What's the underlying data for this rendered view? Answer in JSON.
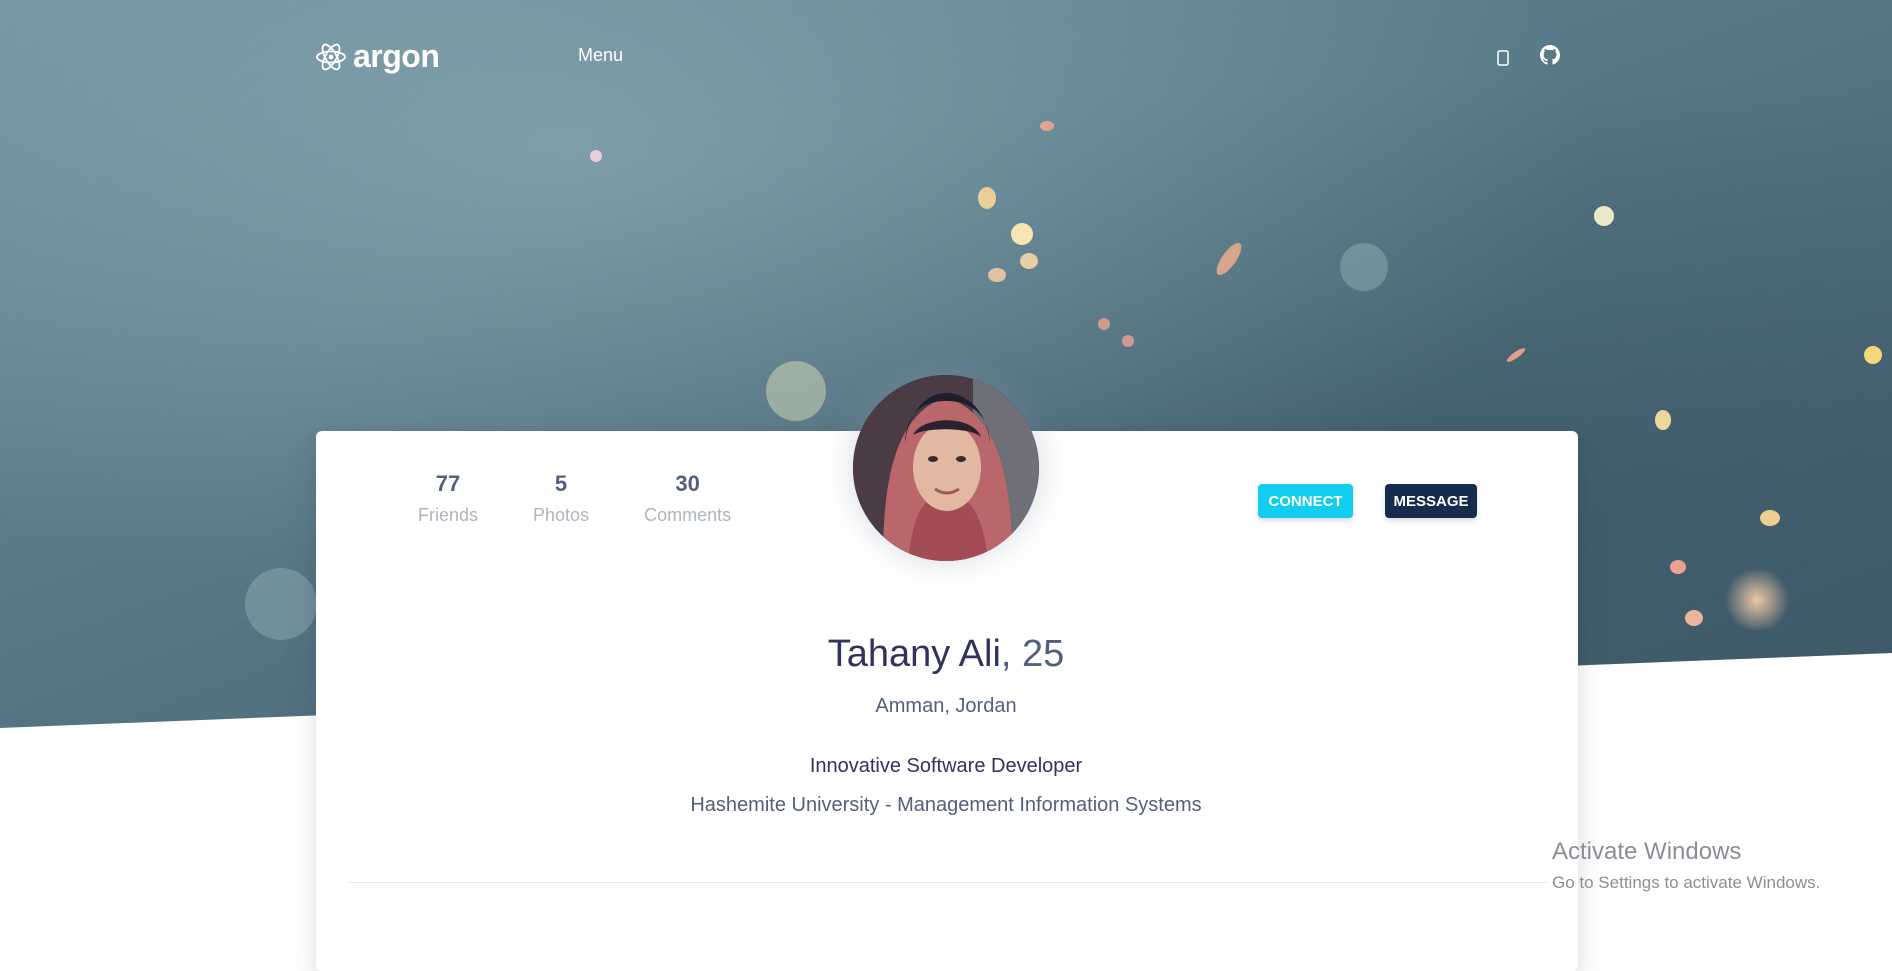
{
  "nav": {
    "brand": "argon",
    "menu_label": "Menu",
    "icons": [
      "mobile-icon",
      "github-icon"
    ]
  },
  "profile": {
    "stats": [
      {
        "value": "77",
        "label": "Friends"
      },
      {
        "value": "5",
        "label": "Photos"
      },
      {
        "value": "30",
        "label": "Comments"
      }
    ],
    "connect_label": "CONNECT",
    "message_label": "MESSAGE",
    "name": "Tahany Ali",
    "age": ", 25",
    "location": "Amman, Jordan",
    "title": "Innovative Software Developer",
    "education": "Hashemite University - Management Information Systems"
  },
  "windows_watermark": {
    "title": "Activate Windows",
    "subtitle": "Go to Settings to activate Windows."
  },
  "colors": {
    "connect": "#11cdef",
    "message": "#172b4d",
    "heading": "#32325d",
    "text": "#525f7f"
  }
}
